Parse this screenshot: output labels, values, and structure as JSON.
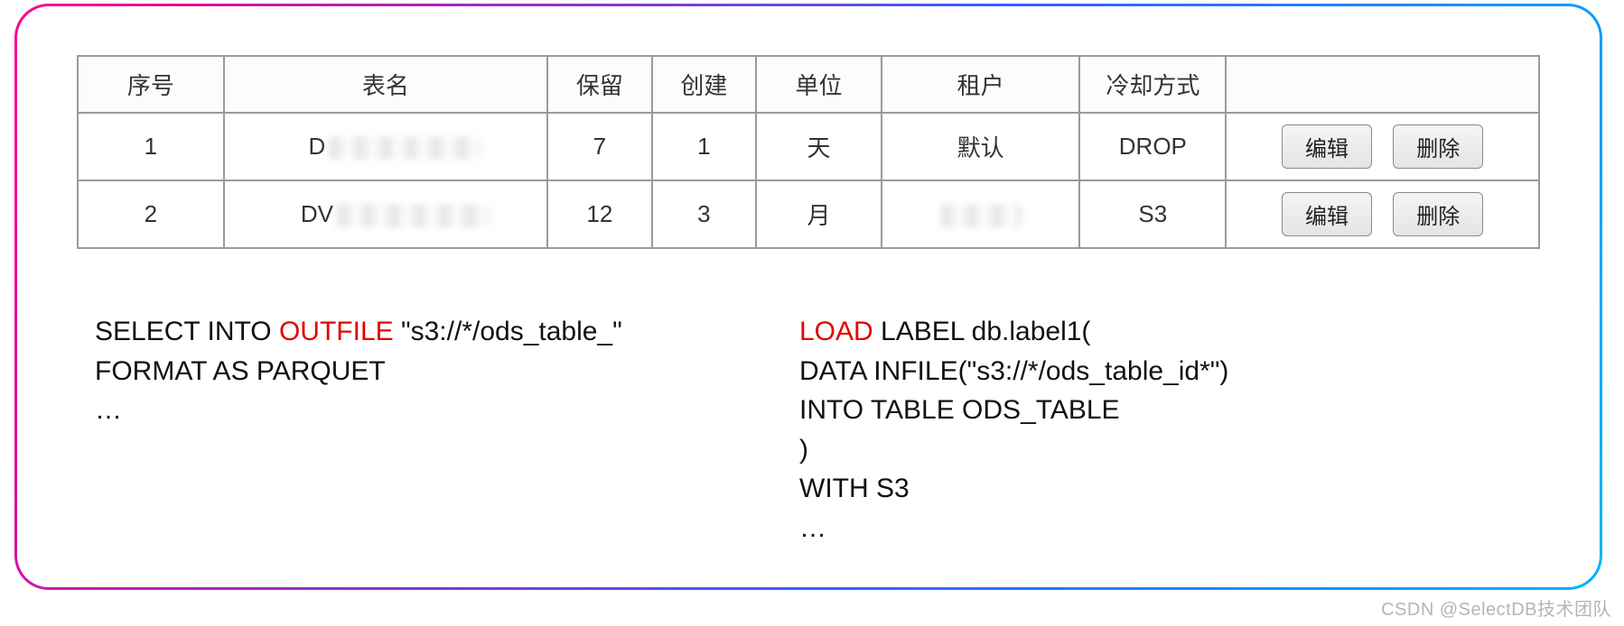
{
  "table": {
    "headers": {
      "index": "序号",
      "name": "表名",
      "keep": "保留",
      "create": "创建",
      "unit": "单位",
      "tenant": "租户",
      "cool": "冷却方式",
      "actions": ""
    },
    "rows": [
      {
        "index": "1",
        "name_prefix": "D",
        "keep": "7",
        "create": "1",
        "unit": "天",
        "tenant": "默认",
        "cool": "DROP"
      },
      {
        "index": "2",
        "name_prefix": "DV",
        "keep": "12",
        "create": "3",
        "unit": "月",
        "tenant": "",
        "cool": "S3"
      }
    ],
    "buttons": {
      "edit": "编辑",
      "delete": "删除"
    }
  },
  "code_left": {
    "l1a": "SELECT INTO ",
    "l1b": "OUTFILE",
    "l1c": " \"s3://*/ods_table_\"",
    "l2": "FORMAT AS PARQUET",
    "l3": "…"
  },
  "code_right": {
    "l1a": "LOAD",
    "l1b": " LABEL db.label1(",
    "l2": "DATA INFILE(\"s3://*/ods_table_id*\")",
    "l3": "INTO TABLE ODS_TABLE",
    "l4": ")",
    "l5": "WITH S3",
    "l6": "…"
  },
  "watermark": "CSDN @SelectDB技术团队"
}
